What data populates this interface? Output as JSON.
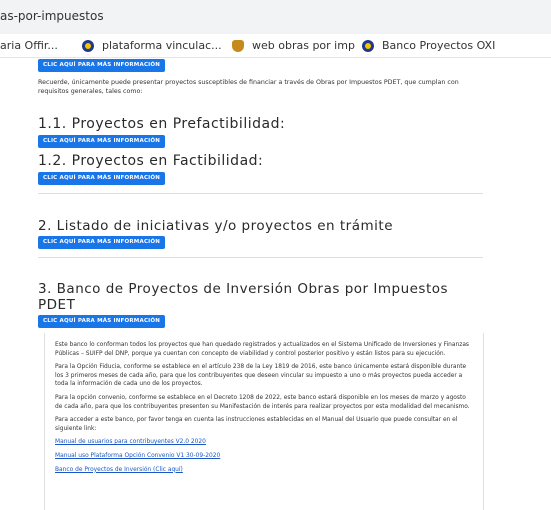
{
  "browser": {
    "url": "as-por-impuestos",
    "bookmarks": [
      {
        "label": "aria Offir...",
        "icon": "none"
      },
      {
        "label": "plataforma vinculac...",
        "icon": "circle-logo-icon"
      },
      {
        "label": "web obras por imp",
        "icon": "shield-logo-icon"
      },
      {
        "label": "Banco Proyectos OXI",
        "icon": "circle-logo-icon"
      }
    ]
  },
  "page": {
    "more_info_label": "CLIC AQUÍ PARA MÁS INFORMACIÓN",
    "intro_text": "Recuerde, únicamente puede presentar proyectos susceptibles de financiar a través de Obras por Impuestos PDET, que cumplan con requisitos generales, tales como:",
    "h_prefact": "1.1. Proyectos en Prefactibilidad:",
    "h_fact": "1.2. Proyectos en Factibilidad:",
    "h_listado": "2. Listado de iniciativas y/o proyectos en trámite",
    "h_banco_line1": "3. Banco de Proyectos de Inversión Obras por Impuestos",
    "h_banco_line2": "PDET",
    "panel": {
      "p1": "Este banco lo conforman todos los proyectos que han quedado registrados y actualizados en el Sistema Unificado de Inversiones y Finanzas Públicas – SUIFP del DNP, porque ya cuentan con concepto de viabilidad y control posterior positivo y están listos para su ejecución.",
      "p2": "Para la Opción Fiducia, conforme se establece en el artículo 238 de la Ley 1819 de 2016, este banco únicamente estará disponible durante los 3 primeros meses de cada año, para que los contribuyentes que deseen vincular su impuesto a uno o más proyectos pueda acceder a toda la información de cada uno de los proyectos.",
      "p3": "Para la opción convenio, conforme se establece en el Decreto 1208 de 2022, este banco estará disponible en los meses de marzo y agosto de cada año, para que los contribuyentes presenten su Manifestación de interés para realizar proyectos por esta modalidad del mecanismo.",
      "p4": "Para acceder a este banco, por favor tenga en cuenta las instrucciones establecidas en el Manual del Usuario que puede consultar en el siguiente link:",
      "link1": "Manual de usuarios para contribuyentes V2.0 2020",
      "link2": "Manual uso Plataforma Opción Convenio V1 30-09-2020",
      "link3": "Banco de Proyectos de Inversión (Clic aquí)"
    }
  }
}
